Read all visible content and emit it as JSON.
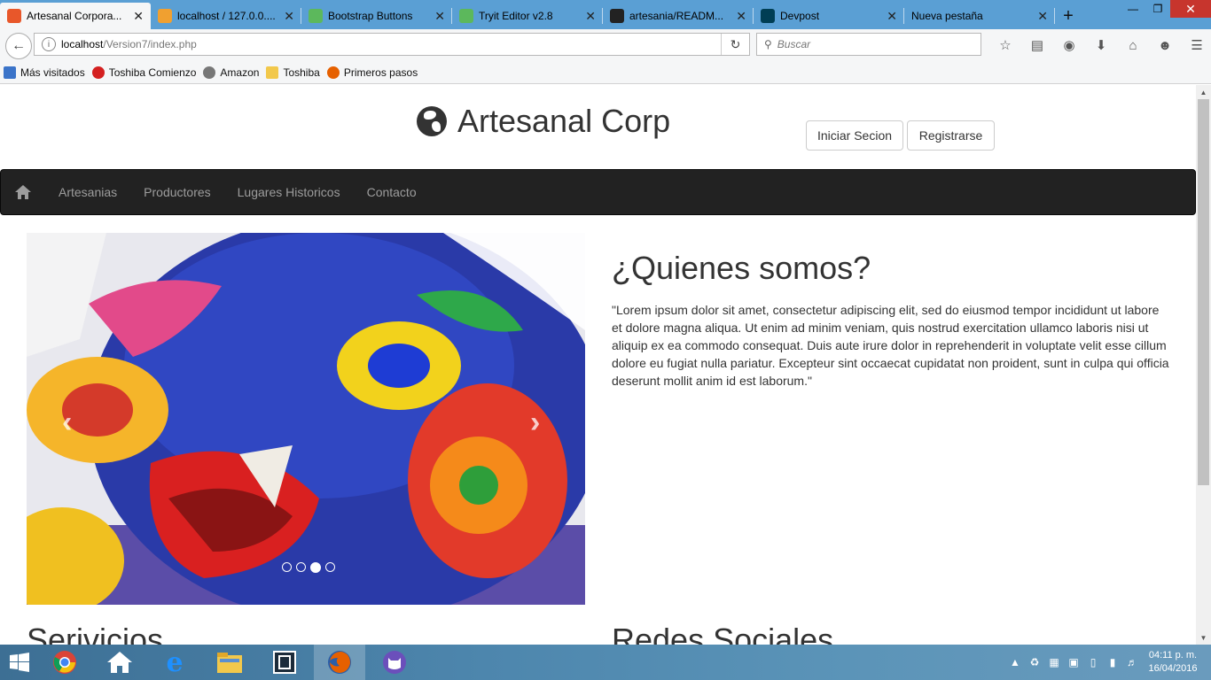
{
  "browser": {
    "tabs": [
      {
        "label": "Artesanal Corpora...",
        "icon": "xampp-icon",
        "color": "#e8572a",
        "active": true
      },
      {
        "label": "localhost / 127.0.0....",
        "icon": "phpmyadmin-icon",
        "color": "#f0a030",
        "active": false
      },
      {
        "label": "Bootstrap Buttons",
        "icon": "w3schools-icon",
        "color": "#5cb85c",
        "active": false
      },
      {
        "label": "Tryit Editor v2.8",
        "icon": "w3schools-icon",
        "color": "#5cb85c",
        "active": false
      },
      {
        "label": "artesania/READM...",
        "icon": "github-icon",
        "color": "#222222",
        "active": false
      },
      {
        "label": "Devpost",
        "icon": "devpost-icon",
        "color": "#003e54",
        "active": false
      },
      {
        "label": "Nueva pestaña",
        "icon": "",
        "color": "",
        "active": false
      }
    ],
    "url_host": "localhost",
    "url_path": "/Version7/index.php",
    "search_placeholder": "Buscar",
    "bookmarks": [
      {
        "label": "Más visitados",
        "icon": "bookmark-folder-icon",
        "color": "#3b74c9"
      },
      {
        "label": "Toshiba Comienzo",
        "icon": "toshiba-icon",
        "color": "#d42020"
      },
      {
        "label": "Amazon",
        "icon": "globe-icon",
        "color": "#777777"
      },
      {
        "label": "Toshiba",
        "icon": "folder-icon",
        "color": "#f2c84b"
      },
      {
        "label": "Primeros pasos",
        "icon": "firefox-icon",
        "color": "#e66000"
      }
    ]
  },
  "site": {
    "brand": "Artesanal Corp",
    "login_label": "Iniciar Secion",
    "register_label": "Registrarse",
    "menu": [
      "Artesanias",
      "Productores",
      "Lugares Historicos",
      "Contacto"
    ],
    "carousel": {
      "slides": 4,
      "active": 2
    },
    "about_title": "¿Quienes somos?",
    "about_text": "\"Lorem ipsum dolor sit amet, consectetur adipiscing elit, sed do eiusmod tempor incididunt ut labore et dolore magna aliqua. Ut enim ad minim veniam, quis nostrud exercitation ullamco laboris nisi ut aliquip ex ea commodo consequat. Duis aute irure dolor in reprehenderit in voluptate velit esse cillum dolore eu fugiat nulla pariatur. Excepteur sint occaecat cupidatat non proident, sunt in culpa qui officia deserunt mollit anim id est laborum.\"",
    "services_title": "Serivicios",
    "social_title": "Redes Sociales"
  },
  "taskbar": {
    "time": "04:11 p. m.",
    "date": "16/04/2016"
  }
}
